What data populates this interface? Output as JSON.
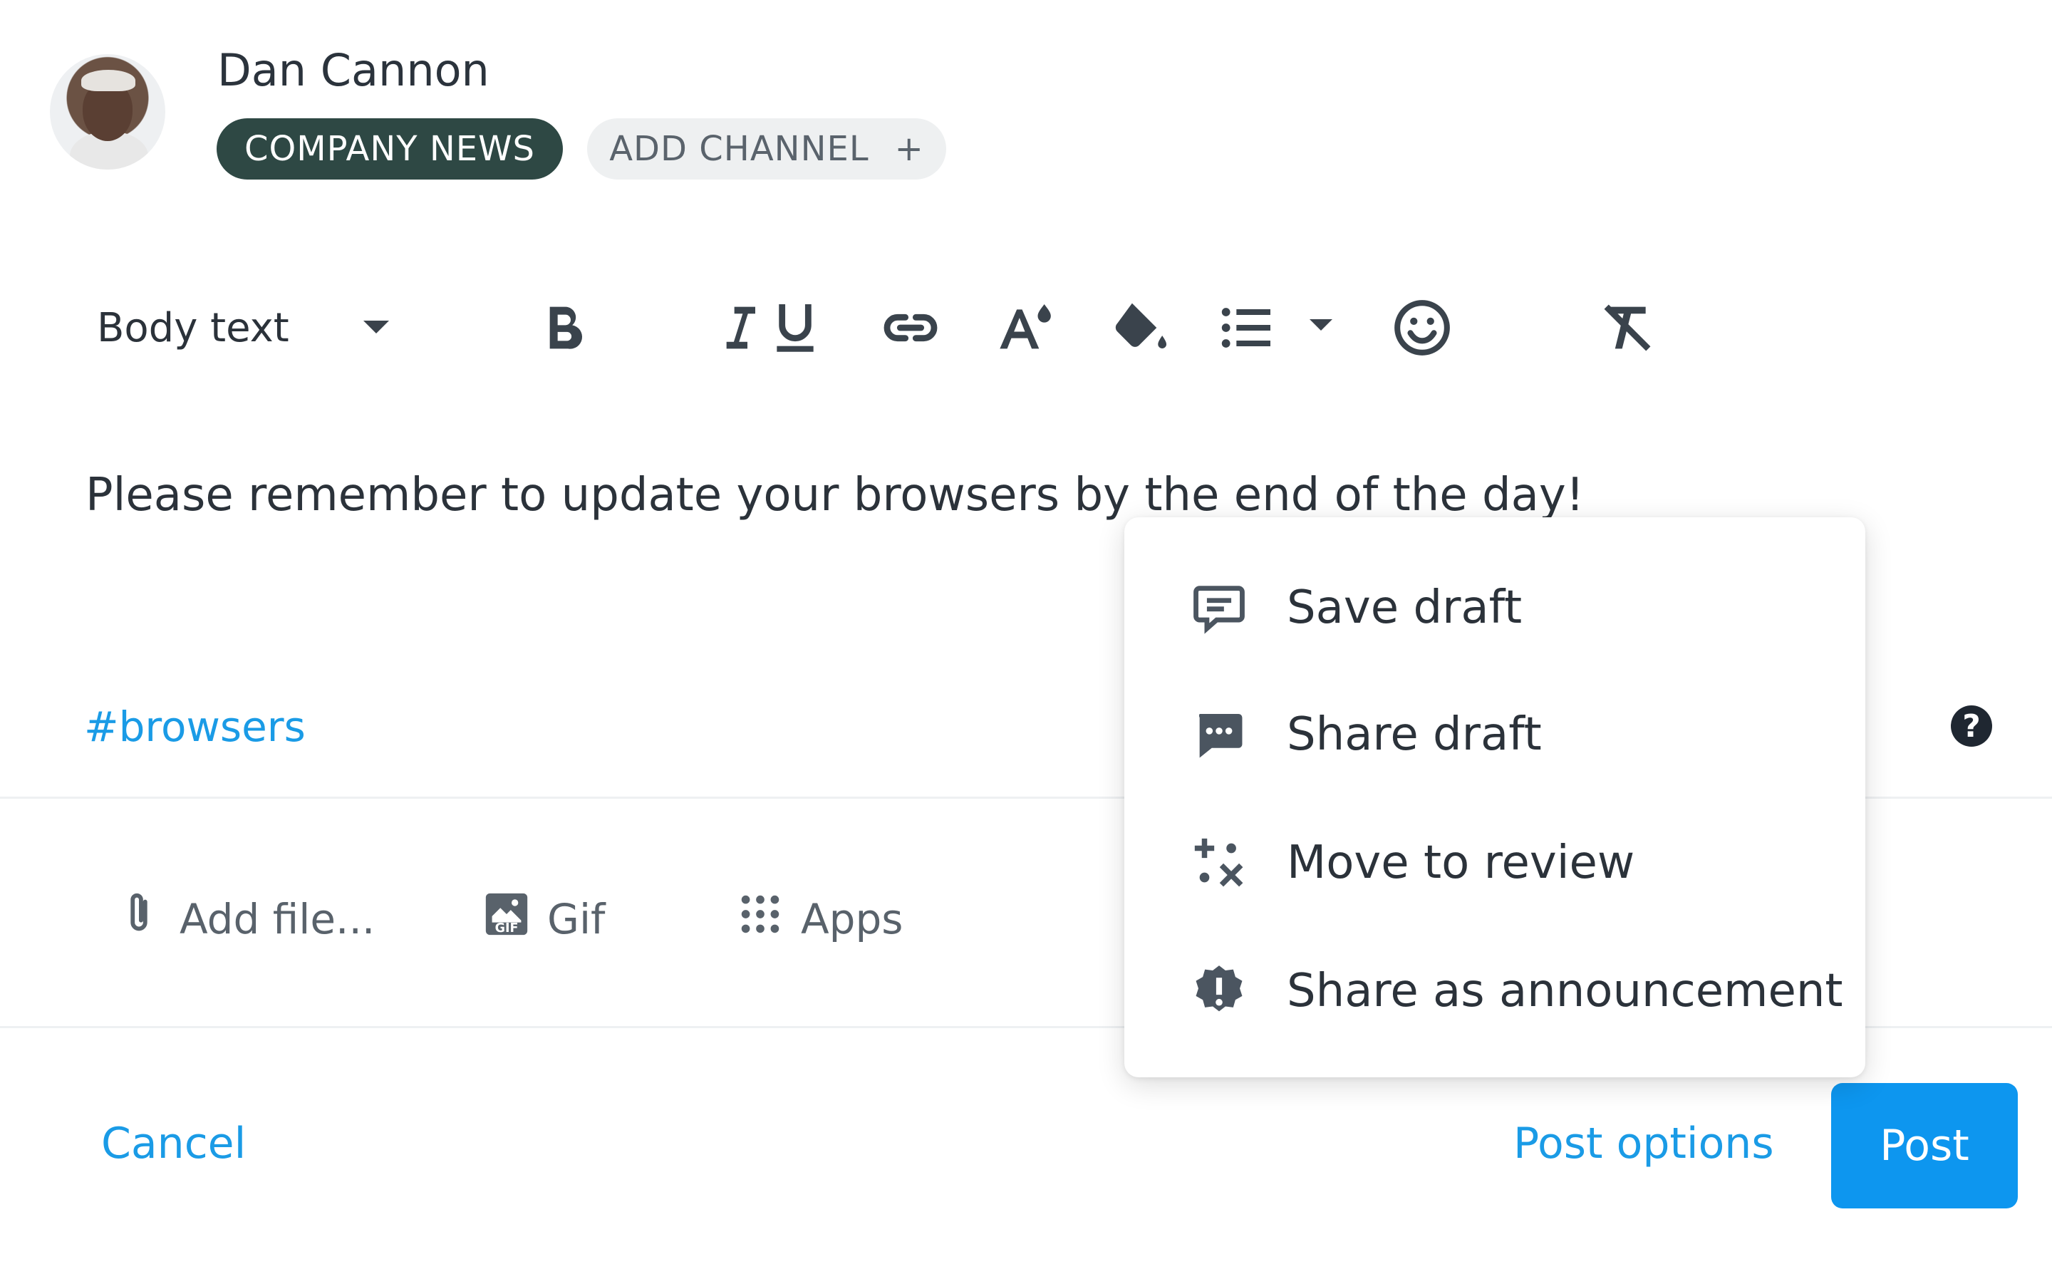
{
  "composer": {
    "author_name": "Dan Cannon",
    "channel_chip": "COMPANY NEWS",
    "add_channel_label": "ADD CHANNEL",
    "add_channel_icon": "+"
  },
  "toolbar": {
    "text_style": "Body text",
    "buttons": [
      "bold-icon",
      "italic-icon",
      "underline-icon",
      "link-icon",
      "text-size-icon",
      "fill-color-icon",
      "bulleted-list-icon",
      "emoji-icon",
      "clear-formatting-icon"
    ]
  },
  "message": {
    "body": "Please remember to update your browsers by the end of the day!",
    "hashtag": "#browsers"
  },
  "attachments": {
    "add_file": "Add file...",
    "gif": "Gif",
    "apps": "Apps"
  },
  "footer": {
    "cancel": "Cancel",
    "post_options": "Post options",
    "post": "Post"
  },
  "post_options_menu": {
    "items": [
      {
        "label": "Save draft",
        "icon": "chat-bubble-icon"
      },
      {
        "label": "Share draft",
        "icon": "chat-dots-icon"
      },
      {
        "label": "Move to review",
        "icon": "review-icon"
      },
      {
        "label": "Share as announcement",
        "icon": "announcement-badge-icon"
      }
    ]
  },
  "colors": {
    "accent": "#1a9be6",
    "post_button": "#0d96ef",
    "channel_chip": "#2e4844"
  }
}
